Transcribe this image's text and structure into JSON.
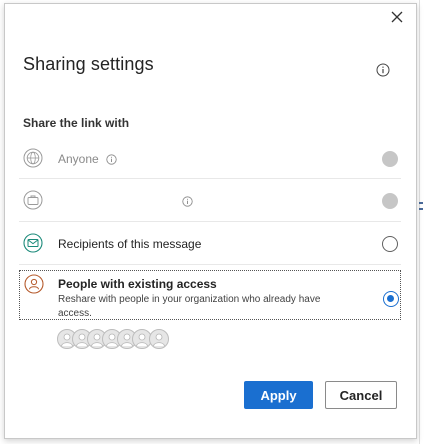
{
  "dialog": {
    "title": "Sharing settings",
    "section_label": "Share the link with",
    "close_icon": "close-icon",
    "info_icon": "info-icon"
  },
  "options": [
    {
      "label": "Anyone",
      "icon": "globe-icon",
      "state": "disabled",
      "has_info": true
    },
    {
      "label": "",
      "icon": "briefcase-icon",
      "state": "disabled",
      "has_info": true
    },
    {
      "label": "Recipients of this message",
      "icon": "mail-icon",
      "state": "unselected",
      "has_info": false
    },
    {
      "label": "People with existing access",
      "description": "Reshare with people in your organization who already have access.",
      "icon": "person-icon",
      "state": "selected",
      "has_info": false
    }
  ],
  "avatars_count": 7,
  "buttons": {
    "apply": "Apply",
    "cancel": "Cancel"
  },
  "colors": {
    "accent": "#1a6fd0",
    "disabled_radio": "#c6c6c6",
    "mail_icon": "#1b8a7a",
    "person_icon": "#b55a2c"
  }
}
